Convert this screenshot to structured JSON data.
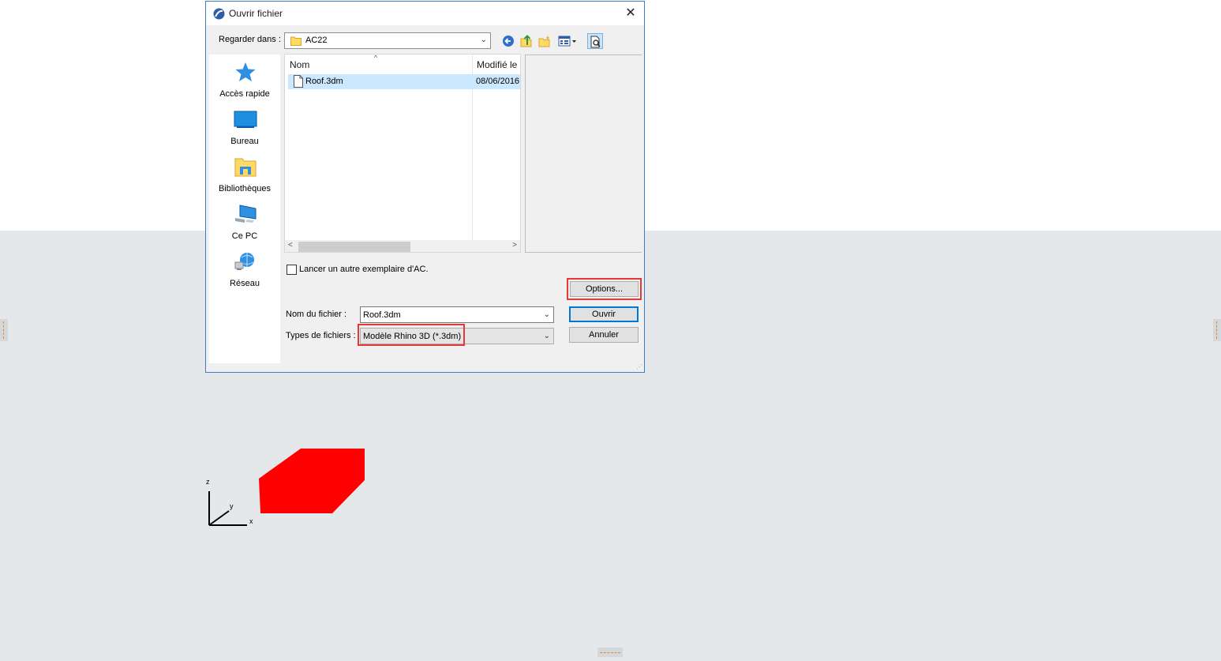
{
  "dialog": {
    "title": "Ouvrir fichier",
    "close_symbol": "✕",
    "look_in_label": "Regarder dans :",
    "look_in_value": "AC22",
    "toolbar": [
      "back-icon",
      "up-folder-icon",
      "new-folder-icon",
      "view-menu-icon",
      "preview-icon"
    ],
    "places": [
      {
        "label": "Accès rapide",
        "icon": "star-icon"
      },
      {
        "label": "Bureau",
        "icon": "desktop-icon"
      },
      {
        "label": "Bibliothèques",
        "icon": "libraries-icon"
      },
      {
        "label": "Ce PC",
        "icon": "computer-icon"
      },
      {
        "label": "Réseau",
        "icon": "network-icon"
      }
    ],
    "columns": {
      "name": "Nom",
      "modified": "Modifié le"
    },
    "files": [
      {
        "name": "Roof.3dm",
        "modified": "08/06/2016",
        "selected": true
      }
    ],
    "checkbox_label": "Lancer un autre exemplaire d'AC.",
    "checkbox_checked": false,
    "options_button": "Options...",
    "file_name_label": "Nom du fichier :",
    "file_name_value": "Roof.3dm",
    "file_type_label": "Types de fichiers :",
    "file_type_value": "Modèle Rhino 3D (*.3dm)",
    "open_button": "Ouvrir",
    "cancel_button": "Annuler"
  },
  "viewport": {
    "axis_labels": {
      "x": "x",
      "y": "y",
      "z": "z"
    },
    "object_color": "#ff0000",
    "background_color": "#e4e8ea"
  },
  "colors": {
    "accent": "#0078d7",
    "highlight": "#e53935",
    "selection": "#cce8ff"
  }
}
